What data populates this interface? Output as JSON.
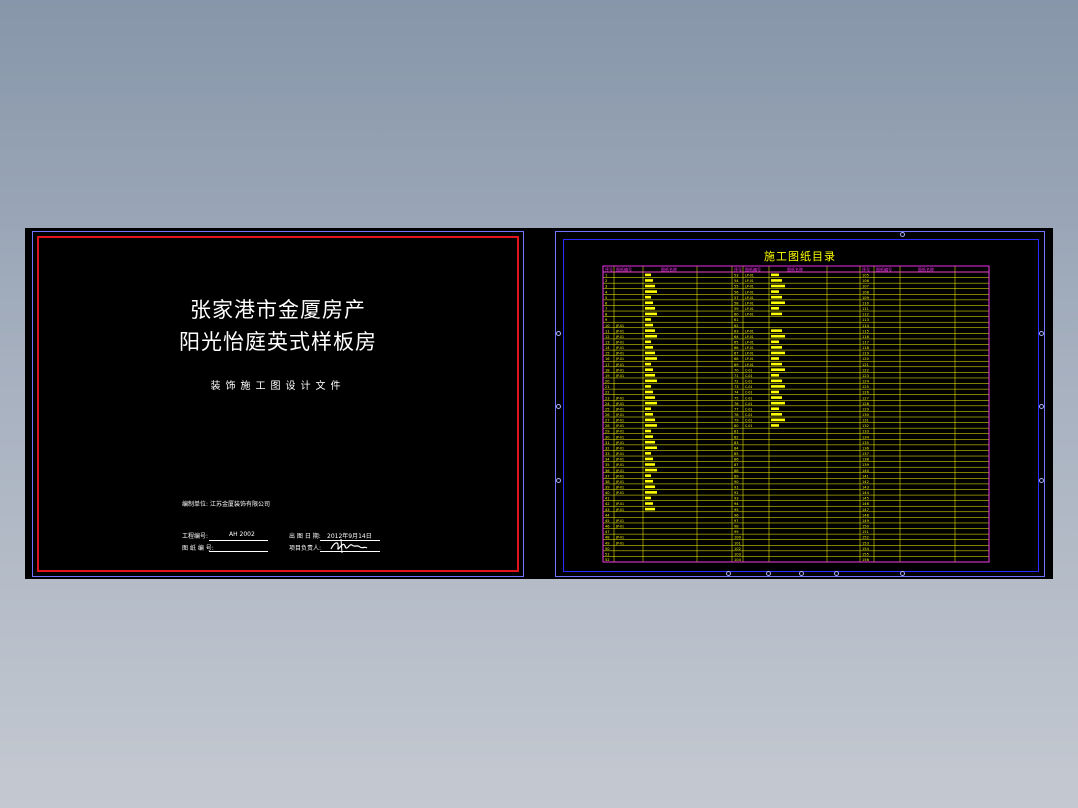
{
  "cover": {
    "title_line1": "张家港市金厦房产",
    "title_line2": "阳光怡庭英式样板房",
    "subtitle": "装饰施工图设计文件",
    "design_unit_label": "编制单位:",
    "design_unit_value": "江苏金厦装饰有限公司",
    "project_no_label": "工程编号:",
    "project_no_value": "AH 2002",
    "design_no_label": "图 纸 编 号:",
    "date_label": "出 图 日 期:",
    "date_value": "2012年9月14日",
    "owner_label": "项目负责人:"
  },
  "index_sheet": {
    "title": "施工图纸目录",
    "headers": [
      "序号",
      "图纸编号",
      "图纸名称"
    ],
    "left_col_numbers": [
      "1",
      "2",
      "3",
      "4",
      "5",
      "6",
      "7",
      "8",
      "9",
      "10",
      "11",
      "12",
      "13",
      "14",
      "15",
      "16",
      "17",
      "18",
      "19",
      "20",
      "21",
      "22",
      "23",
      "24",
      "25",
      "26",
      "27",
      "28",
      "29",
      "30",
      "31",
      "32",
      "33",
      "34",
      "35",
      "36",
      "37",
      "38",
      "39",
      "40",
      "41",
      "42",
      "43",
      "44",
      "45",
      "46",
      "47",
      "48",
      "49",
      "50",
      "51",
      "52"
    ],
    "mid_col_numbers": [
      "53",
      "54",
      "55",
      "56",
      "57",
      "58",
      "59",
      "60",
      "61",
      "62",
      "63",
      "64",
      "65",
      "66",
      "67",
      "68",
      "69",
      "70",
      "71",
      "72",
      "73",
      "74",
      "75",
      "76",
      "77",
      "78",
      "79",
      "80",
      "81",
      "82",
      "83",
      "84",
      "85",
      "86",
      "87",
      "88",
      "89",
      "90",
      "91",
      "92",
      "93",
      "94",
      "95",
      "96",
      "97",
      "98",
      "99",
      "100",
      "101",
      "102",
      "103",
      "104"
    ],
    "right_col_numbers": [
      "105",
      "106",
      "107",
      "108",
      "109",
      "110",
      "111",
      "112",
      "113",
      "114",
      "115",
      "116",
      "117",
      "118",
      "119",
      "120",
      "121",
      "122",
      "123",
      "124",
      "125",
      "126",
      "127",
      "128",
      "129",
      "130",
      "131",
      "132",
      "133",
      "134",
      "135",
      "136",
      "137",
      "138",
      "139",
      "140",
      "141",
      "142",
      "143",
      "144",
      "145",
      "146",
      "147",
      "148",
      "149",
      "150",
      "151",
      "152",
      "153",
      "154",
      "155",
      "156"
    ],
    "left_code": "JP-01",
    "mid_code": "LP-01",
    "mid_code2": "C-01",
    "grid_color": "#ffff00",
    "frame_color": "#ff33ff"
  },
  "colors": {
    "background": "#000000",
    "cover_frame": "#e0141c",
    "outer_frame": "#6e74ff",
    "text": "#ffffff",
    "accent": "#ffff00"
  }
}
